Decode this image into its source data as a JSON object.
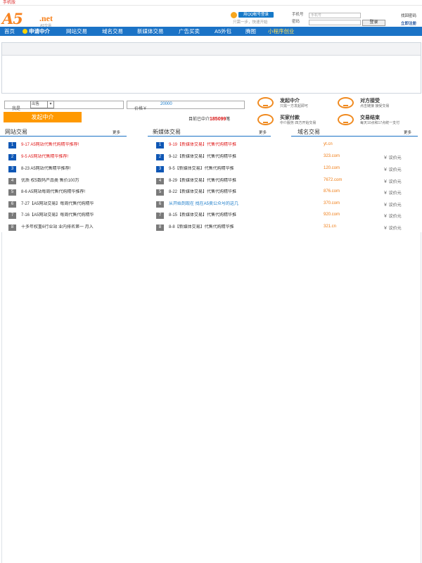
{
  "topbar": {
    "mobile_link": "手机版"
  },
  "logo": {
    "brand": "A5",
    "net": ".net",
    "sub": "A5交易"
  },
  "qq": {
    "button": "用QQ帐号登录",
    "tip": "只需一步，快速开始"
  },
  "login": {
    "phone_label": "手机号",
    "phone_placeholder": "手机号",
    "password_label": "密码",
    "login_button": "登录",
    "find_password": "找回密码",
    "register": "立即注册"
  },
  "nav": [
    {
      "label": "首页"
    },
    {
      "label": "申请中介"
    },
    {
      "label": "网站交易"
    },
    {
      "label": "域名交易"
    },
    {
      "label": "新媒体交易"
    },
    {
      "label": "广告买卖"
    },
    {
      "label": "A5外包"
    },
    {
      "label": "腾图"
    },
    {
      "label": "小程序创业"
    }
  ],
  "search": {
    "role_label": "我是",
    "role_value": "出售",
    "price_label": "价格￥",
    "price_value": "20000",
    "launch_button": "发起中介",
    "in_progress_prefix": "目前已中介",
    "in_progress_count": "185099",
    "in_progress_suffix": "笔"
  },
  "steps": [
    {
      "title": "发起中介",
      "desc": "只需一方发起即可"
    },
    {
      "title": "对方接受",
      "desc": "点击链接 接受交易"
    },
    {
      "title": "买家付款",
      "desc": "中介服务 四方开始交易"
    },
    {
      "title": "交易结束",
      "desc": "每天10点和17点统一支付"
    }
  ],
  "website_col": {
    "title": "网站交易",
    "more": "更多",
    "items": [
      {
        "num": "1",
        "text": "9-17 A5网站代售代购精华推荐!"
      },
      {
        "num": "2",
        "text": "9-5 A5网站代售精华推荐!"
      },
      {
        "num": "3",
        "text": "8-23 A5网站代售精华推荐!"
      },
      {
        "num": "4",
        "text": "优质  权5数码产品类  售价100万"
      },
      {
        "num": "5",
        "text": "8-6 A5网站每周代售代购精华推荐!"
      },
      {
        "num": "6",
        "text": "7-27【A5网站交易】每周代售代购精华"
      },
      {
        "num": "7",
        "text": "7-16【A5网站交易】每周代售代购精华"
      },
      {
        "num": "8",
        "text": "十多年权重6行业站  业内排名第一  月入"
      }
    ]
  },
  "media_col": {
    "title": "新媒体交易",
    "more": "更多",
    "items": [
      {
        "num": "1",
        "text": "9-19【新媒体交易】代售代购精华推"
      },
      {
        "num": "2",
        "text": "9-12【新媒体交易】代售代购精华推"
      },
      {
        "num": "3",
        "text": "9-5【新媒体交易】代售代购精华推"
      },
      {
        "num": "4",
        "text": "8-29【新媒体交易】代售代购精华推"
      },
      {
        "num": "5",
        "text": "8-22【新媒体交易】代售代购精华推"
      },
      {
        "num": "6",
        "text": "从开始到现在  找在A5卖公众号的这几"
      },
      {
        "num": "7",
        "text": "8-15【新媒体交易】代售代购精华推"
      },
      {
        "num": "8",
        "text": "8-8【新媒体交易】代售代购精华推"
      }
    ]
  },
  "domain_col": {
    "title": "域名交易",
    "more": "更多",
    "items": [
      {
        "name": "yt.cn",
        "price": ""
      },
      {
        "name": "323.com",
        "price": "￥ 议价元"
      },
      {
        "name": "120.com",
        "price": "￥ 议价元"
      },
      {
        "name": "7672.com",
        "price": "￥ 议价元"
      },
      {
        "name": "876.com",
        "price": "￥ 议价元"
      },
      {
        "name": "370.com",
        "price": "￥ 议价元"
      },
      {
        "name": "920.com",
        "price": "￥ 议价元"
      },
      {
        "name": "321.cn",
        "price": "￥ 议价元"
      }
    ]
  },
  "colors": {
    "nav_blue": "#1b73c6",
    "accent_orange": "#ff9900",
    "link_red": "#e02020",
    "domain_orange": "#f07b12"
  }
}
